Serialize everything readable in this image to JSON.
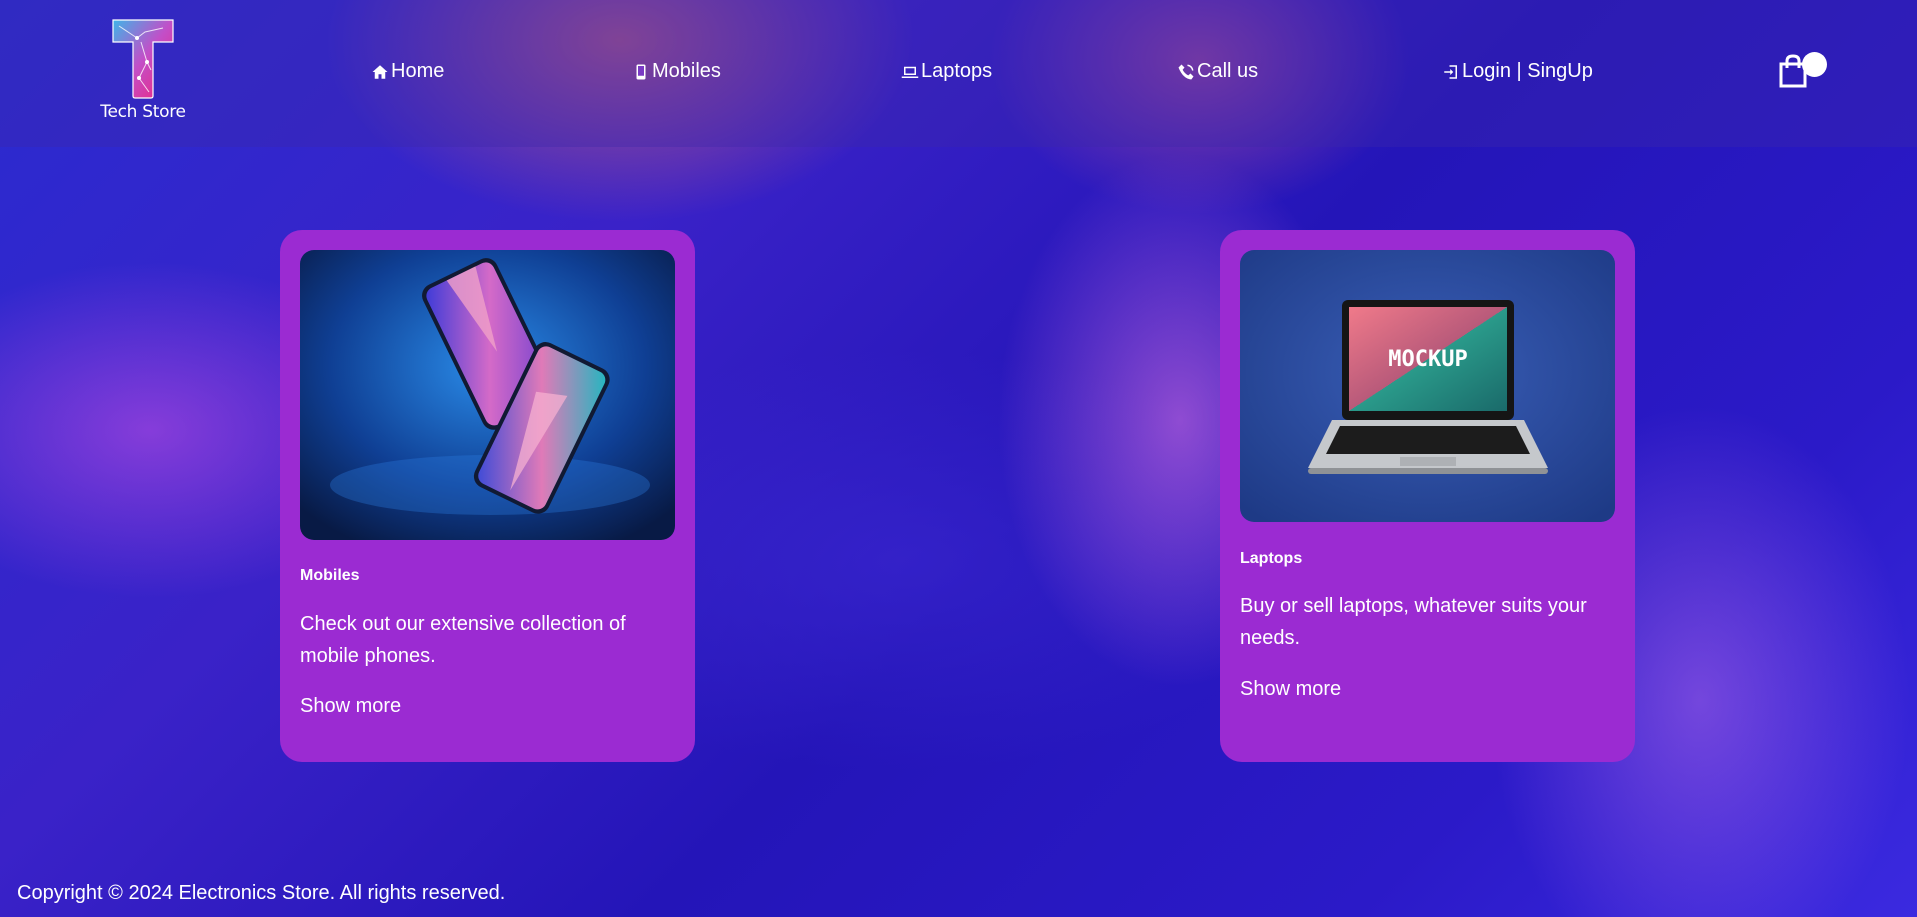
{
  "brand": {
    "name": "Tech Store",
    "logo_letter": "T"
  },
  "nav": [
    {
      "label": "Home",
      "icon": "home-icon"
    },
    {
      "label": "Mobiles",
      "icon": "mobile-icon"
    },
    {
      "label": "Laptops",
      "icon": "laptop-icon"
    },
    {
      "label": "Call us",
      "icon": "phone-icon"
    },
    {
      "label": "Login | SingUp",
      "icon": "login-icon"
    }
  ],
  "cart": {
    "icon": "shopping-bag-icon"
  },
  "cards": [
    {
      "title": "Mobiles",
      "description": "Check out our extensive collection of mobile phones.",
      "link": "Show more",
      "image": "phones-image"
    },
    {
      "title": "Laptops",
      "description": "Buy or sell laptops, whatever suits your needs.",
      "link": "Show more",
      "image": "laptop-mockup-image",
      "image_text": "MOCKUP"
    }
  ],
  "footer": {
    "copyright": "Copyright © 2024 Electronics Store. All rights reserved."
  },
  "colors": {
    "card_bg": "#9b2bd2",
    "text": "#ffffff",
    "accent": "#e2268a"
  }
}
